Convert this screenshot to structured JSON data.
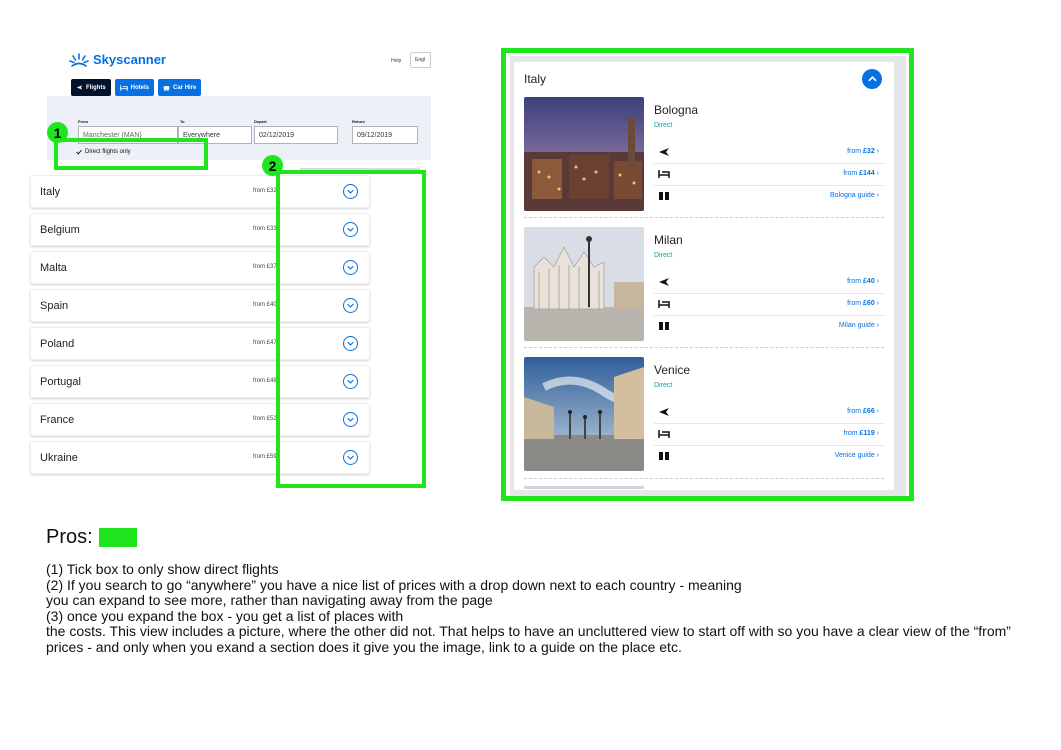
{
  "colors": {
    "highlight": "#1fe51f",
    "brand": "#0770e3",
    "tab_dark": "#02122c",
    "direct": "#00a698"
  },
  "left": {
    "brand": "Skyscanner",
    "help": "Help",
    "lang": "Engl",
    "tabs": [
      {
        "label": "Flights",
        "icon": "plane-icon"
      },
      {
        "label": "Hotels",
        "icon": "bed-icon"
      },
      {
        "label": "Car Hire",
        "icon": "car-icon"
      }
    ],
    "from_label": "From",
    "to_label": "To",
    "depart_label": "Depart",
    "return_label": "Return",
    "from_value": "Manchester (MAN)",
    "to_value": "Everywhere",
    "depart_value": "02/12/2019",
    "return_value": "09/12/2019",
    "direct_only": "Direct flights only",
    "countries": [
      {
        "name": "Italy",
        "price": "from £32"
      },
      {
        "name": "Belgium",
        "price": "from £33"
      },
      {
        "name": "Malta",
        "price": "from £37"
      },
      {
        "name": "Spain",
        "price": "from £40"
      },
      {
        "name": "Poland",
        "price": "from £47"
      },
      {
        "name": "Portugal",
        "price": "from £48"
      },
      {
        "name": "France",
        "price": "from £52"
      },
      {
        "name": "Ukraine",
        "price": "from £59"
      }
    ],
    "markers": [
      "1",
      "2"
    ]
  },
  "right": {
    "region": "Italy",
    "cities": [
      {
        "name": "Bologna",
        "direct": "Direct",
        "flight_prefix": "from ",
        "flight_price": "£32",
        "hotel_prefix": "from ",
        "hotel_price": "£144",
        "guide": "Bologna guide"
      },
      {
        "name": "Milan",
        "direct": "Direct",
        "flight_prefix": "from ",
        "flight_price": "£40",
        "hotel_prefix": "from ",
        "hotel_price": "£60",
        "guide": "Milan guide"
      },
      {
        "name": "Venice",
        "direct": "Direct",
        "flight_prefix": "from ",
        "flight_price": "£66",
        "hotel_prefix": "from ",
        "hotel_price": "£119",
        "guide": "Venice guide"
      }
    ]
  },
  "pros_label": "Pros:",
  "notes": [
    "(1) Tick box to only show direct flights",
    "(2) If you search to go “anywhere” you have a nice list of prices with a drop down next to each country - meaning",
    "you can expand to see more, rather than navigating away from the page",
    "(3) once you expand the box - you get a list of places with",
    "the costs. This view includes a picture, where the other did not. That helps to have an uncluttered view to start off with so you have a clear view of the “from” prices - and only when you exand a section does it give you the image, link to a guide on the place etc."
  ]
}
